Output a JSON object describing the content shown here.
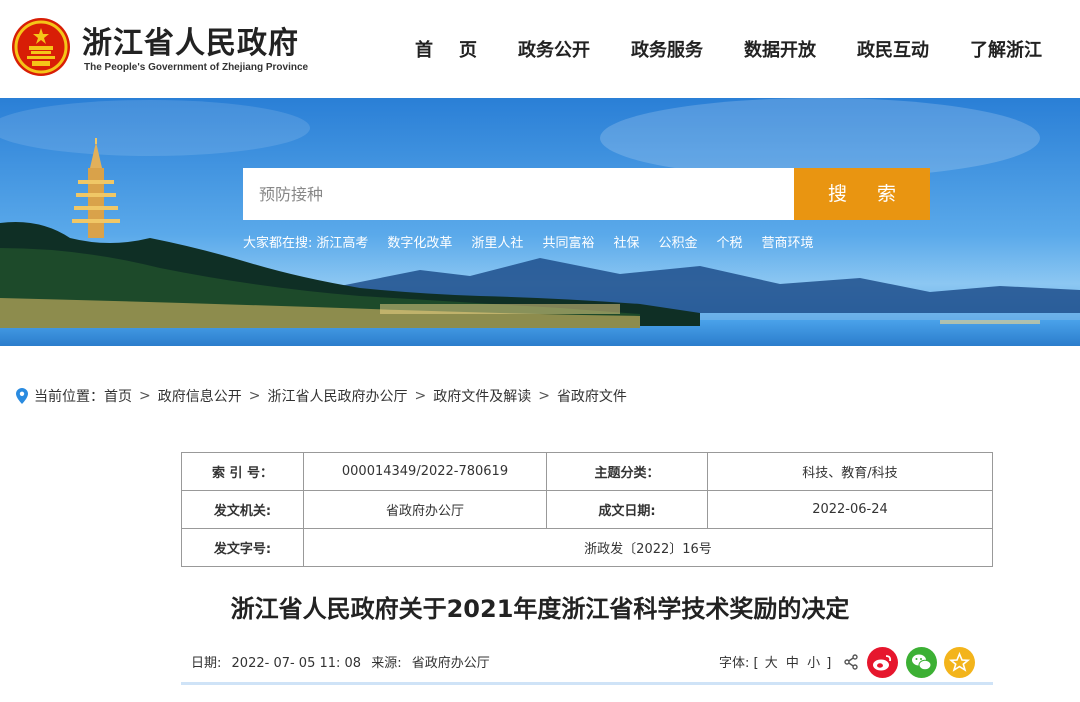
{
  "header": {
    "title": "浙江省人民政府",
    "subtitle": "The People's Government of Zhejiang Province",
    "nav": [
      "首页",
      "政务公开",
      "政务服务",
      "数据开放",
      "政民互动",
      "了解浙江"
    ]
  },
  "search": {
    "placeholder": "预防接种",
    "button_label": "搜 索",
    "hot_label": "大家都在搜:",
    "hot_terms": [
      "浙江高考",
      "数字化改革",
      "浙里人社",
      "共同富裕",
      "社保",
      "公积金",
      "个税",
      "营商环境"
    ]
  },
  "breadcrumb": {
    "label": "当前位置：",
    "items": [
      "首页",
      "政府信息公开",
      "浙江省人民政府办公厅",
      "政府文件及解读",
      "省政府文件"
    ]
  },
  "info": {
    "index_label": "索 引 号：",
    "index_value": "000014349/2022-780619",
    "topic_label": "主题分类：",
    "topic_value": "科技、教育/科技",
    "issuer_label": "发文机关:",
    "issuer_value": "省政府办公厅",
    "date_label": "成文日期:",
    "date_value": "2022-06-24",
    "docno_label": "发文字号:",
    "docno_value": "浙政发〔2022〕16号"
  },
  "article": {
    "title": "浙江省人民政府关于2021年度浙江省科学技术奖励的决定",
    "date_label": "日期:",
    "date_value": "2022- 07- 05 11: 08",
    "source_label": "来源:",
    "source_value": "省政府办公厅",
    "font_label": "字体:",
    "font_open": "[",
    "font_large": "大",
    "font_medium": "中",
    "font_small": "小",
    "font_close": "]"
  },
  "colors": {
    "accent_orange": "#e99511",
    "weibo_red": "#e6162d",
    "wechat_green": "#3cb034",
    "fav_yellow": "#f3b41b"
  }
}
